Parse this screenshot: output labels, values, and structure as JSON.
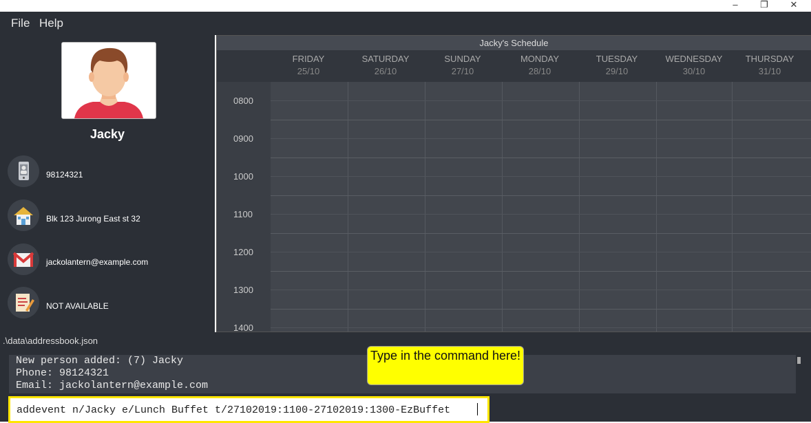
{
  "window": {
    "minimize_icon": "–",
    "restore_icon": "❐",
    "close_icon": "✕"
  },
  "menu": {
    "file": "File",
    "help": "Help"
  },
  "person": {
    "name": "Jacky",
    "phone": "98124321",
    "address": "Blk 123 Jurong East st 32",
    "email": "jackolantern@example.com",
    "remark": "NOT AVAILABLE",
    "icons": [
      "phone-icon",
      "house-icon",
      "email-icon",
      "notepad-icon"
    ]
  },
  "schedule": {
    "title": "Jacky's Schedule",
    "days": [
      {
        "name": "FRIDAY",
        "date": "25/10"
      },
      {
        "name": "SATURDAY",
        "date": "26/10"
      },
      {
        "name": "SUNDAY",
        "date": "27/10"
      },
      {
        "name": "MONDAY",
        "date": "28/10"
      },
      {
        "name": "TUESDAY",
        "date": "29/10"
      },
      {
        "name": "WEDNESDAY",
        "date": "30/10"
      },
      {
        "name": "THURSDAY",
        "date": "31/10"
      }
    ],
    "times": [
      "0800",
      "0900",
      "1000",
      "1100",
      "1200",
      "1300",
      "1400"
    ]
  },
  "status": {
    "path": ".\\data\\addressbook.json"
  },
  "result": {
    "lines": [
      "New person added: (7) Jacky",
      "Phone: 98124321",
      "Email: jackolantern@example.com"
    ]
  },
  "command": {
    "value": "addevent n/Jacky e/Lunch Buffet t/27102019:1100-27102019:1300-EzBuffet"
  },
  "callout": {
    "text": "Type in the command here!"
  },
  "colors": {
    "background": "#2b2f36",
    "highlight": "#ffff00"
  }
}
